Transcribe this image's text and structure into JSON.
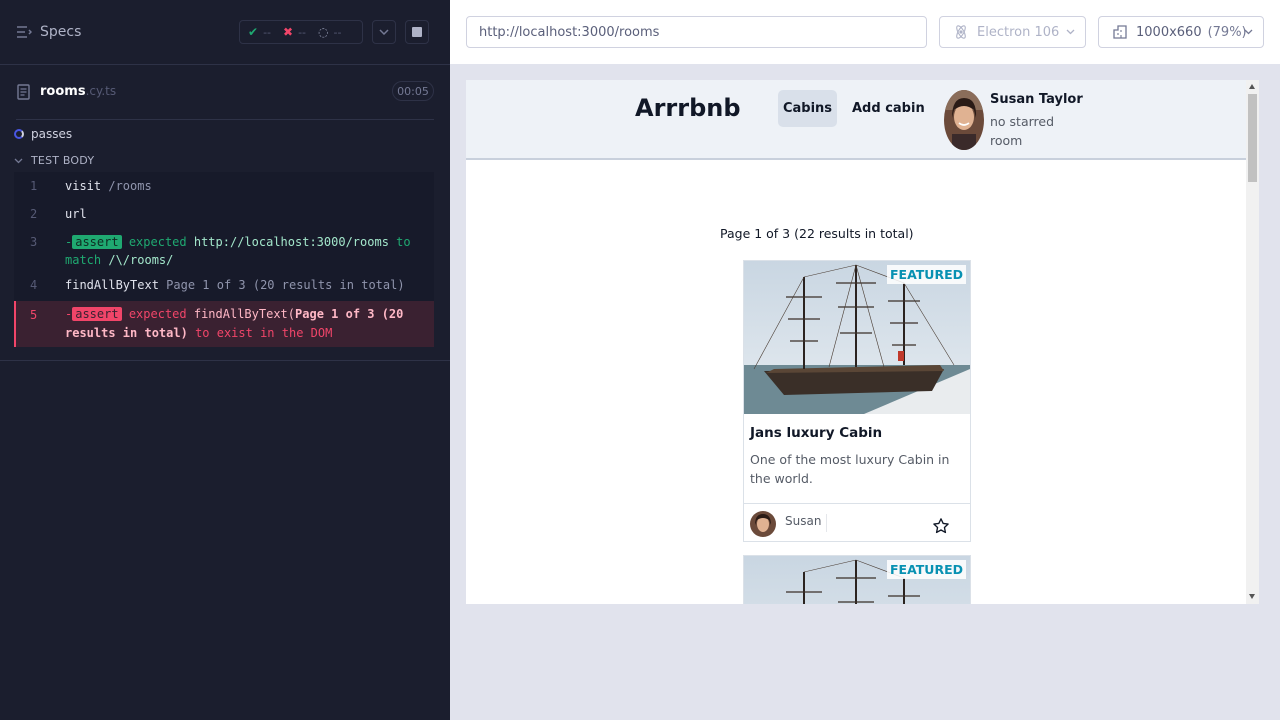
{
  "runner": {
    "specs_title": "Specs",
    "stats": {
      "passed": "--",
      "failed": "--",
      "pending": "--"
    },
    "spec_file": {
      "name": "rooms",
      "ext": ".cy.ts",
      "duration": "00:05"
    },
    "suite": {
      "title": "passes"
    },
    "test_body_label": "TEST BODY",
    "commands": [
      {
        "num": "1",
        "name": "visit",
        "arg": "/rooms"
      },
      {
        "num": "2",
        "name": "url"
      },
      {
        "num": "3",
        "dash": "-",
        "badge": "assert",
        "expected": "expected",
        "value": "http://localhost:3000/rooms",
        "to": "to",
        "match": "match",
        "pattern": "/\\/rooms/"
      },
      {
        "num": "4",
        "name": "findAllByText",
        "arg": "Page 1 of 3 (20 results in total)"
      },
      {
        "num": "5",
        "dash": "-",
        "badge": "assert",
        "expected": "expected",
        "value_fn": "findAllByText(",
        "value_text_1": "Page 1 of 3 (20",
        "value_text_2": "results in total)",
        "tail": "to exist in the DOM"
      }
    ],
    "colors": {
      "pass": "#1fa971",
      "fail": "#f14569",
      "bg": "#1b1e2e"
    }
  },
  "aut": {
    "url": "http://localhost:3000/rooms",
    "browser": "Electron 106",
    "viewport": "1000x660",
    "zoom": "(79%)"
  },
  "app": {
    "brand": "Arrrbnb",
    "nav": {
      "cabins": "Cabins",
      "add_cabin": "Add cabin"
    },
    "user": {
      "name": "Susan Taylor",
      "status": "no starred room"
    },
    "pagination_info": "Page 1 of 3 (22 results in total)",
    "cards": [
      {
        "featured": "FEATURED",
        "title": "Jans luxury Cabin",
        "description": "One of the most luxury Cabin in the world.",
        "owner": "Susan",
        "star_icon": "star-outline-icon"
      },
      {
        "featured": "FEATURED"
      }
    ]
  }
}
